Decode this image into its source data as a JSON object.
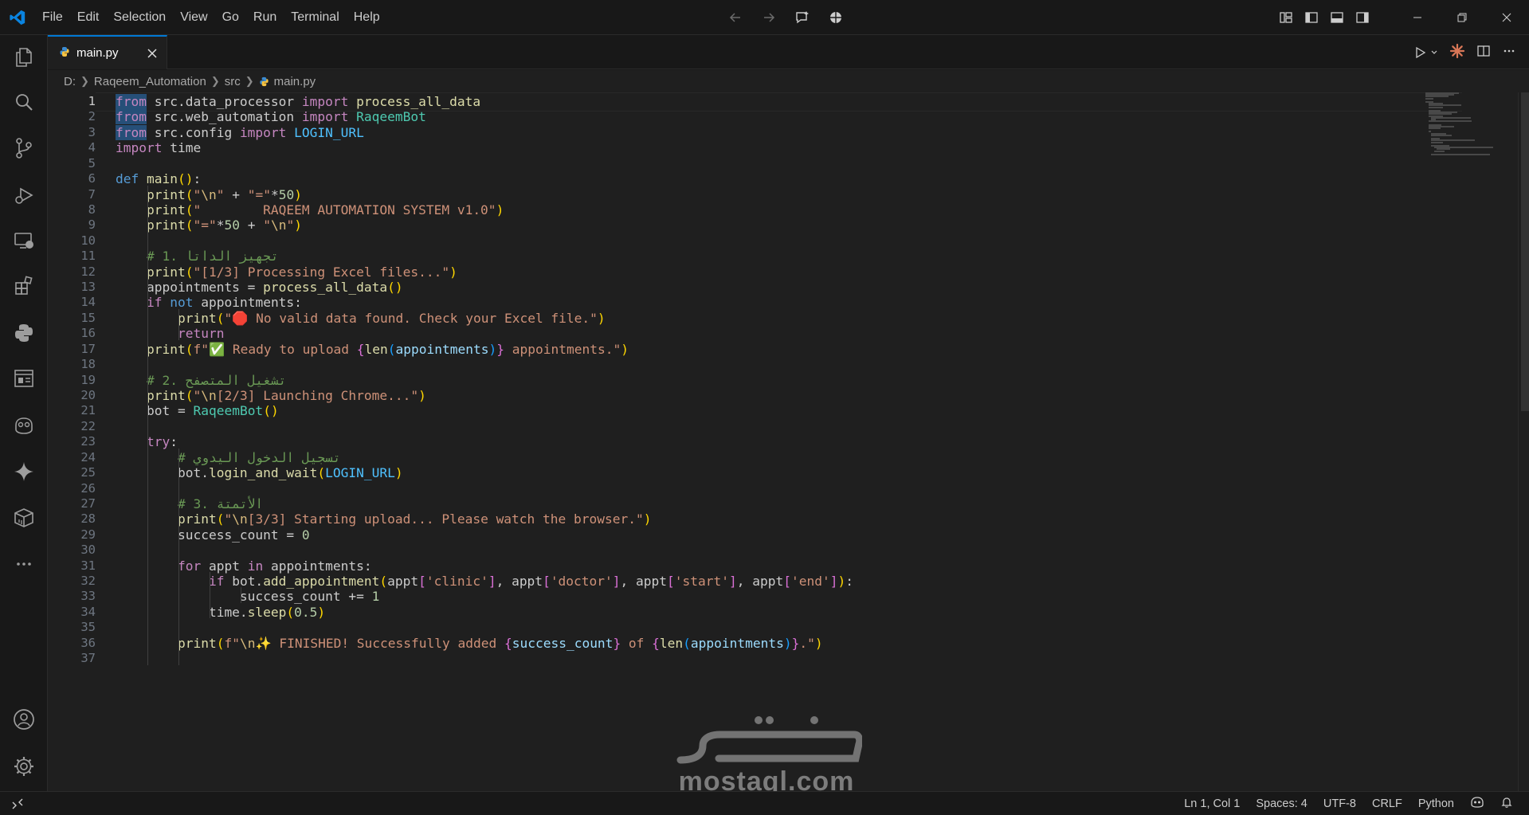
{
  "menu": [
    "File",
    "Edit",
    "Selection",
    "View",
    "Go",
    "Run",
    "Terminal",
    "Help"
  ],
  "tab": {
    "label": "main.py"
  },
  "breadcrumbs": [
    "D:",
    "Raqeem_Automation",
    "src",
    "main.py"
  ],
  "status": {
    "position": "Ln 1, Col 1",
    "spaces": "Spaces: 4",
    "encoding": "UTF-8",
    "eol": "CRLF",
    "language": "Python"
  },
  "watermark": {
    "text": "mostaql.com",
    "logo_text": "مستقل"
  },
  "editor": {
    "current_line": 1,
    "lines": [
      "from src.data_processor import process_all_data",
      "from src.web_automation import RaqeemBot",
      "from src.config import LOGIN_URL",
      "import time",
      "",
      "def main():",
      "    print(\"\\n\" + \"=\"*50)",
      "    print(\"        RAQEEM AUTOMATION SYSTEM v1.0\")",
      "    print(\"=\"*50 + \"\\n\")",
      "",
      "    # 1. تجهيز الداتا",
      "    print(\"[1/3] Processing Excel files...\")",
      "    appointments = process_all_data()",
      "    if not appointments:",
      "        print(\"🛑 No valid data found. Check your Excel file.\")",
      "        return",
      "    print(f\"✅ Ready to upload {len(appointments)} appointments.\")",
      "",
      "    # 2. تشغيل المتصفح",
      "    print(\"\\n[2/3] Launching Chrome...\")",
      "    bot = RaqeemBot()",
      "",
      "    try:",
      "        # تسجيل الدخول اليدوي",
      "        bot.login_and_wait(LOGIN_URL)",
      "",
      "        # 3. الأتمتة",
      "        print(\"\\n[3/3] Starting upload... Please watch the browser.\")",
      "        success_count = 0",
      "",
      "        for appt in appointments:",
      "            if bot.add_appointment(appt['clinic'], appt['doctor'], appt['start'], appt['end']):",
      "                success_count += 1",
      "            time.sleep(0.5)",
      "",
      "        print(f\"\\n✨ FINISHED! Successfully added {success_count} of {len(appointments)}.\")",
      ""
    ]
  },
  "colors": {
    "accent": "#0078d4",
    "keyword_control": "#c586c0",
    "keyword": "#569cd6",
    "function": "#dcdcaa",
    "string": "#ce9178",
    "comment": "#6a9955"
  }
}
